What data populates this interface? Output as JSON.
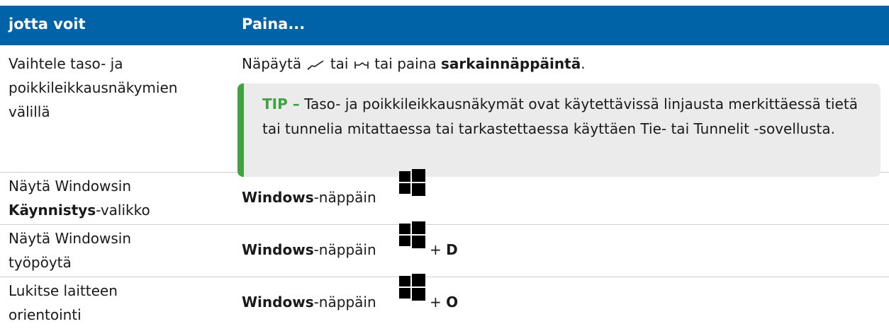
{
  "header": {
    "col1": "jotta voit",
    "col2": "Paina..."
  },
  "rows": [
    {
      "col1": [
        "Vaihtele taso- ja",
        "poikkileikkausnäkymien",
        "välillä"
      ],
      "col2_prefix": "Näpäytä",
      "col2_mid": "tai",
      "col2_suffix": "tai paina",
      "col2_bold": "sarkainnäppäintä",
      "col2_end": ".",
      "icons": [
        "plan-view-icon",
        "cross-section-icon"
      ],
      "tip": {
        "label": "TIP –",
        "text": "Taso- ja poikkileikkausnäkymät ovat käytettävissä linjausta merkittäessä tietä tai tunnelia mitattaessa tai tarkastettaessa käyttäen Tie- tai Tunnelit -sovellusta."
      }
    },
    {
      "col1_line1": "Näytä Windowsin",
      "col1_bold": "Käynnistys",
      "col1_rest": "-valikko",
      "key_bold": "Windows",
      "key_rest": "-näppäin",
      "icon": "windows-logo-icon"
    },
    {
      "col1": [
        "Näytä Windowsin",
        "työpöytä"
      ],
      "key_bold": "Windows",
      "key_rest": "-näppäin",
      "plus": "+",
      "key2": "D",
      "icon": "windows-logo-icon"
    },
    {
      "col1": [
        "Lukitse laitteen",
        "orientointi"
      ],
      "key_bold": "Windows",
      "key_rest": "-näppäin",
      "plus": "+",
      "key2": "O",
      "icon": "windows-logo-icon"
    }
  ],
  "colors": {
    "header_bg": "#0063a8",
    "tip_accent": "#3fa33f",
    "tip_bg": "#ebebeb"
  }
}
